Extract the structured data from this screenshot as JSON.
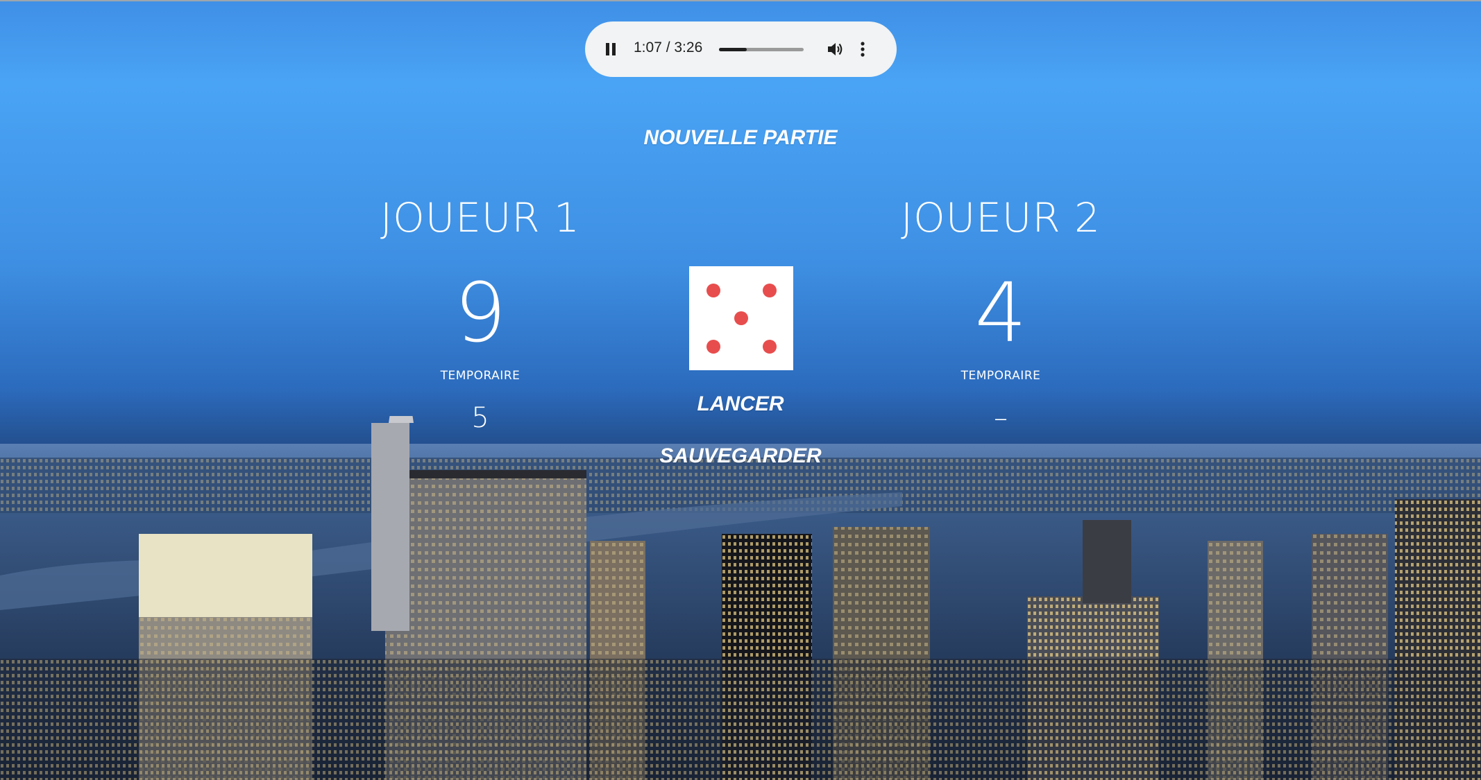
{
  "audio": {
    "time": "1:07 / 3:26",
    "progress_fraction": 0.325,
    "play_state_icon": "pause-icon",
    "volume_icon": "volume-icon",
    "menu_icon": "more-vert-icon"
  },
  "game": {
    "new_game_label": "NOUVELLE PARTIE",
    "roll_label": "LANCER",
    "save_label": "SAUVEGARDER",
    "dice_value": 5,
    "dice_pip_color": "#e84d4d"
  },
  "players": [
    {
      "title": "JOUEUR 1",
      "score": "9",
      "temp_label": "TEMPORAIRE",
      "temp_value": "5"
    },
    {
      "title": "JOUEUR 2",
      "score": "4",
      "temp_label": "TEMPORAIRE",
      "temp_value": "–"
    }
  ]
}
